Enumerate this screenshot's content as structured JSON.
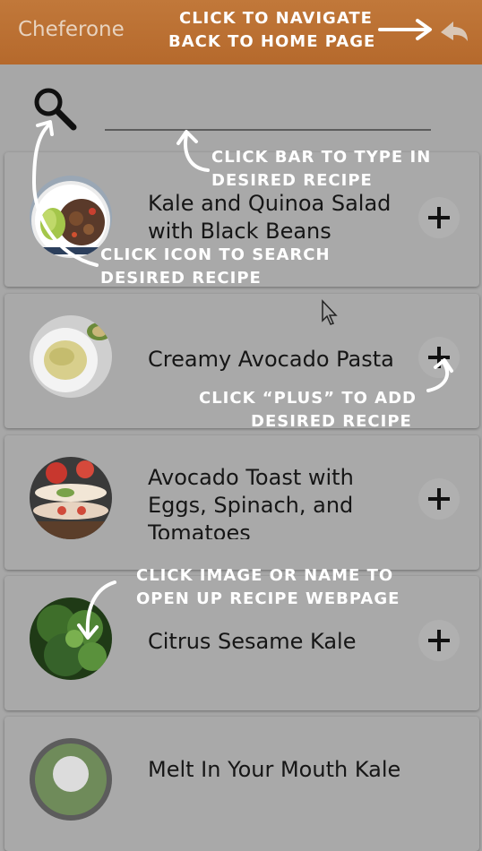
{
  "app": {
    "title": "Cheferone"
  },
  "search": {
    "placeholder": ""
  },
  "recipes": [
    {
      "name": "Kale and Quinoa Salad with Black Beans",
      "add_icon": "plus-icon"
    },
    {
      "name": "Creamy Avocado Pasta",
      "add_icon": "plus-icon"
    },
    {
      "name": "Avocado Toast with Eggs, Spinach, and Tomatoes",
      "add_icon": "plus-icon"
    },
    {
      "name": "Citrus Sesame Kale",
      "add_icon": "plus-icon"
    },
    {
      "name": "Melt In Your Mouth Kale",
      "add_icon": "plus-icon"
    }
  ],
  "annotations": {
    "navigate_line1": "CLICK TO NAVIGATE",
    "navigate_line2": "BACK TO HOME PAGE",
    "type_line1": "CLICK BAR TO TYPE IN",
    "type_line2": "DESIRED RECIPE",
    "search_line1": "CLICK ICON TO SEARCH",
    "search_line2": "DESIRED RECIPE",
    "plus_line1": "CLICK “PLUS” TO ADD",
    "plus_line2": "DESIRED RECIPE",
    "image_line1": "CLICK IMAGE OR NAME TO",
    "image_line2": "OPEN UP RECIPE WEBPAGE"
  },
  "colors": {
    "appbar": "#b5692c",
    "background": "#a7a7a7",
    "card": "#a9a9a9",
    "annotation_text": "#ffffff"
  }
}
